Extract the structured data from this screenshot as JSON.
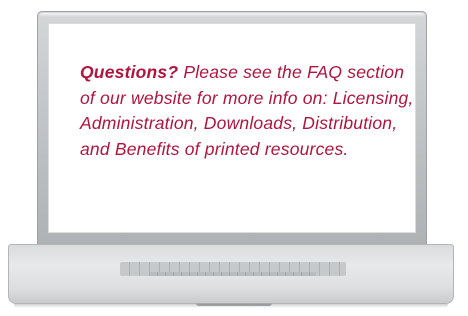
{
  "message": {
    "lead": "Questions?",
    "body": " Please see the FAQ section of our website for more info on: Licensing, Administration, Downloads, Distribution, and Benefits of printed resources."
  },
  "colors": {
    "text": "#b0153e",
    "body_text_style": "italic"
  }
}
